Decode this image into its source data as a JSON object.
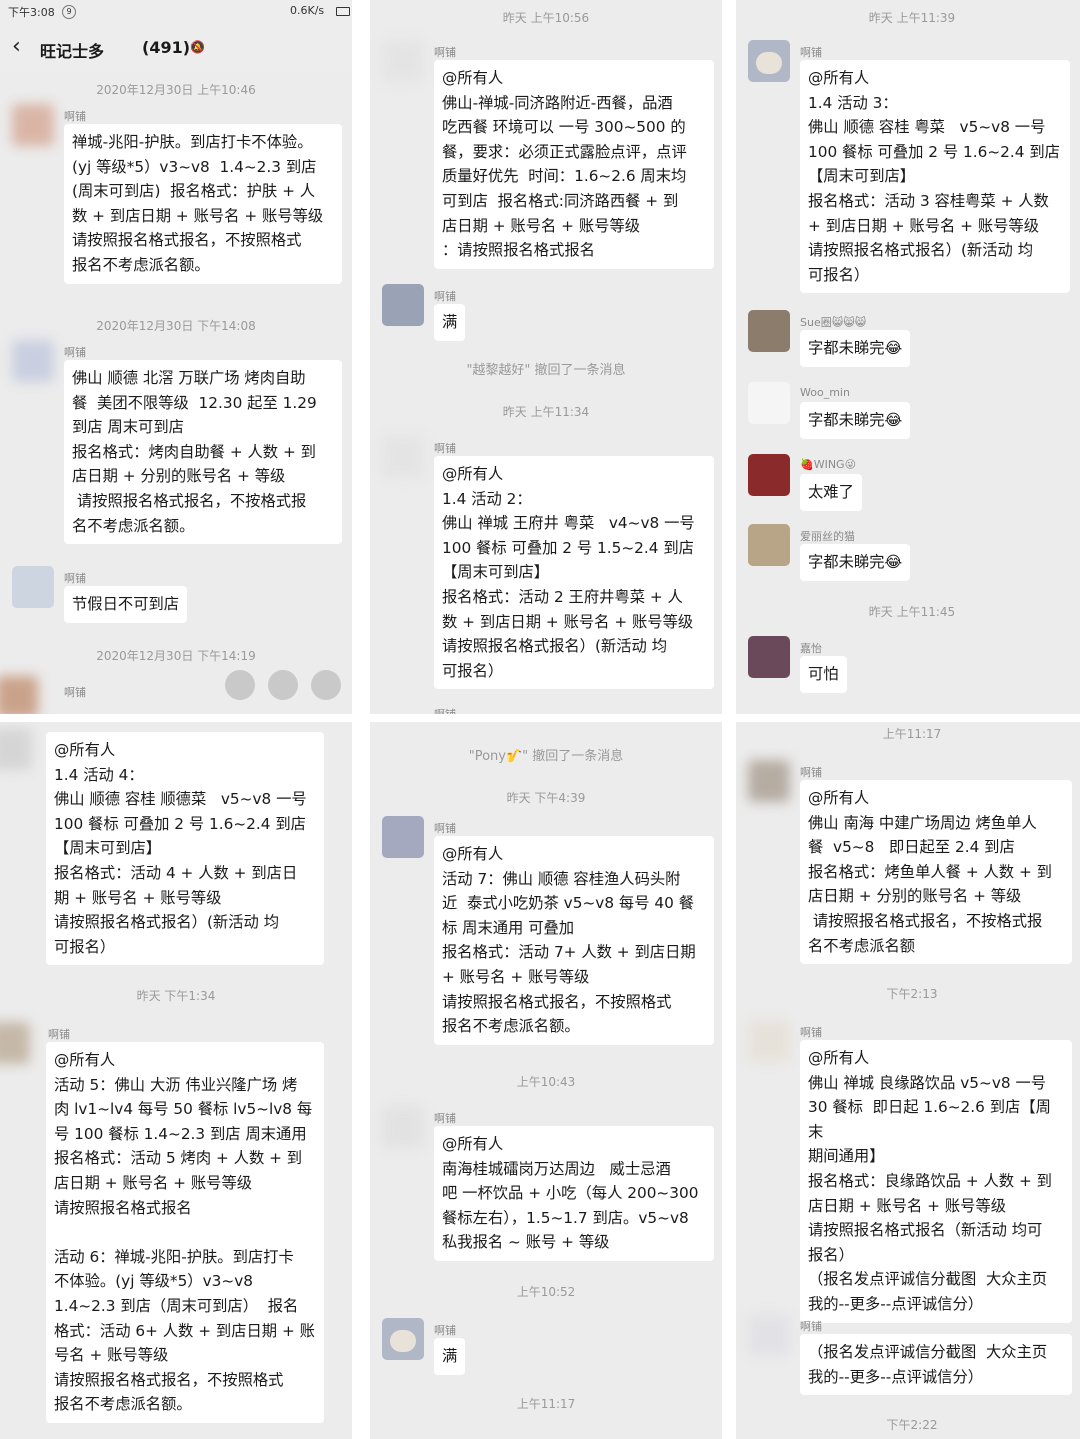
{
  "status_bar": {
    "time": "下午3:08",
    "notif": "9",
    "speed": "0.6K/s"
  },
  "chat": {
    "title": "旺记士多",
    "count": "(491)"
  },
  "colors": {
    "bg": "#ececec",
    "bubble": "#ffffff",
    "timestamp": "#9a9a9a"
  },
  "panel1": {
    "ts1": "2020年12月30日 上午10:46",
    "m1_name": "啊铺",
    "m1_text": "禅城-兆阳-护肤。到店打卡不体验。\n(yj 等级*5）v3~v8  1.4~2.3 到店\n(周末可到店)  报名格式：护肤 + 人\n数 + 到店日期 + 账号名 + 账号等级\n请按照报名格式报名，不按照格式\n报名不考虑派名额。",
    "ts2": "2020年12月30日 下午14:08",
    "m2_name": "啊铺",
    "m2_text": "佛山 顺德 北滘 万联广场 烤肉自助\n餐  美团不限等级  12.30 起至 1.29\n到店 周末可到店\n报名格式：烤肉自助餐 + 人数 + 到\n店日期 + 分别的账号名 + 等级\n 请按照报名格式报名，不按格式报\n名不考虑派名额。",
    "m3_name": "啊铺",
    "m3_text": "节假日不可到店",
    "ts3": "2020年12月30日 下午14:19",
    "m4_name": "啊铺"
  },
  "panel2": {
    "ts1": "昨天 上午10:56",
    "m1_name": "啊铺",
    "m1_text": "@所有人\n佛山-禅城-同济路附近-西餐，品酒\n吃西餐 环境可以 一号 300~500 的\n餐，要求：必须正式露脸点评，点评\n质量好优先  时间：1.6~2.6 周末均\n可到店  报名格式:同济路西餐 + 到\n店日期 + 账号名 + 账号等级\n：请按照报名格式报名",
    "m2_name": "啊铺",
    "m2_text": "满",
    "sys": "\"越黎越好\" 撤回了一条消息",
    "ts2": "昨天 上午11:34",
    "m3_name": "啊铺",
    "m3_text": "@所有人\n1.4 活动 2：\n佛山 禅城 王府井 粤菜   v4~v8 一号\n100 餐标 可叠加 2 号 1.5~2.4 到店\n【周末可到店】\n报名格式：活动 2 王府井粤菜 + 人\n数 + 到店日期 + 账号名 + 账号等级\n请按照报名格式报名）(新活动 均\n可报名）",
    "m4_name": "啊铺"
  },
  "panel3": {
    "ts1": "昨天 上午11:39",
    "m1_name": "啊铺",
    "m1_text": "@所有人\n1.4 活动 3：\n佛山 顺德 容桂 粤菜   v5~v8 一号\n100 餐标 可叠加 2 号 1.6~2.4 到店\n【周末可到店】\n报名格式：活动 3 容桂粤菜 + 人数\n+ 到店日期 + 账号名 + 账号等级\n请按照报名格式报名）(新活动 均\n可报名）",
    "m2_name": "Sue圈😸😸😸",
    "m2_text": "字都未睇完😂",
    "m3_name": "Woo_min",
    "m3_text": "字都未睇完😂",
    "m4_name": "🍓WING😜",
    "m4_text": "太难了",
    "m5_name": "爱丽丝的猫",
    "m5_text": "字都未睇完😂",
    "ts2": "昨天 上午11:45",
    "m6_name": "嘉怡",
    "m6_text": "可怕"
  },
  "panel4": {
    "m1_text": "@所有人\n1.4 活动 4：\n佛山 顺德 容桂 顺德菜   v5~v8 一号\n100 餐标 可叠加 2 号 1.6~2.4 到店\n【周末可到店】\n报名格式：活动 4 + 人数 + 到店日\n期 + 账号名 + 账号等级\n请按照报名格式报名）(新活动 均\n可报名）",
    "ts1": "昨天 下午1:34",
    "m2_name": "啊铺",
    "m2_text": "@所有人\n活动 5：佛山 大沥 伟业兴隆广场 烤\n肉 lv1~lv4 每号 50 餐标 lv5~lv8 每\n号 100 餐标 1.4~2.3 到店 周末通用\n报名格式：活动 5 烤肉 + 人数 + 到\n店日期 + 账号名 + 账号等级\n请按照报名格式报名\n\n活动 6：禅城-兆阳-护肤。到店打卡\n不体验。(yj 等级*5）v3~v8\n1.4~2.3 到店（周末可到店）  报名\n格式：活动 6+ 人数 + 到店日期 + 账\n号名 + 账号等级\n请按照报名格式报名，不按照格式\n报名不考虑派名额。"
  },
  "panel5": {
    "sys": "\"Pony🎷\" 撤回了一条消息",
    "ts1": "昨天 下午4:39",
    "m1_name": "啊铺",
    "m1_text": "@所有人\n活动 7：佛山 顺德 容桂渔人码头附\n近  泰式小吃奶茶 v5~v8 每号 40 餐\n标 周末通用 可叠加\n报名格式：活动 7+ 人数 + 到店日期\n+ 账号名 + 账号等级\n请按照报名格式报名，不按照格式\n报名不考虑派名额。",
    "ts2": "上午10:43",
    "m2_name": "啊铺",
    "m2_text": "@所有人\n南海桂城礌岗万达周边   威士忌酒\n吧 一杯饮品 + 小吃（每人 200~300\n餐标左右），1.5~1.7 到店。v5~v8\n私我报名 ~ 账号 + 等级",
    "ts3": "上午10:52",
    "m3_name": "啊铺",
    "m3_text": "满",
    "ts4": "上午11:17"
  },
  "panel6": {
    "ts1": "上午11:17",
    "m1_name": "啊铺",
    "m1_text": "@所有人\n佛山 南海 中建广场周边 烤鱼单人\n餐  v5~8   即日起至 2.4 到店\n报名格式：烤鱼单人餐 + 人数 + 到\n店日期 + 分别的账号名 + 等级\n 请按照报名格式报名，不按格式报\n名不考虑派名额",
    "ts2": "下午2:13",
    "m2_name": "啊铺",
    "m2_text": "@所有人\n佛山 禅城 良缘路饮品 v5~v8 一号\n30 餐标  即日起 1.6~2.6 到店【周末\n期间通用】\n报名格式：良缘路饮品 + 人数 + 到\n店日期 + 账号名 + 账号等级\n请按照报名格式报名（新活动 均可\n报名）\n（报名发点评诚信分截图  大众主页\n我的--更多--点评诚信分）",
    "m3_name": "啊铺",
    "m3_text": "（报名发点评诚信分截图  大众主页\n我的--更多--点评诚信分）",
    "ts3": "下午2:22"
  }
}
